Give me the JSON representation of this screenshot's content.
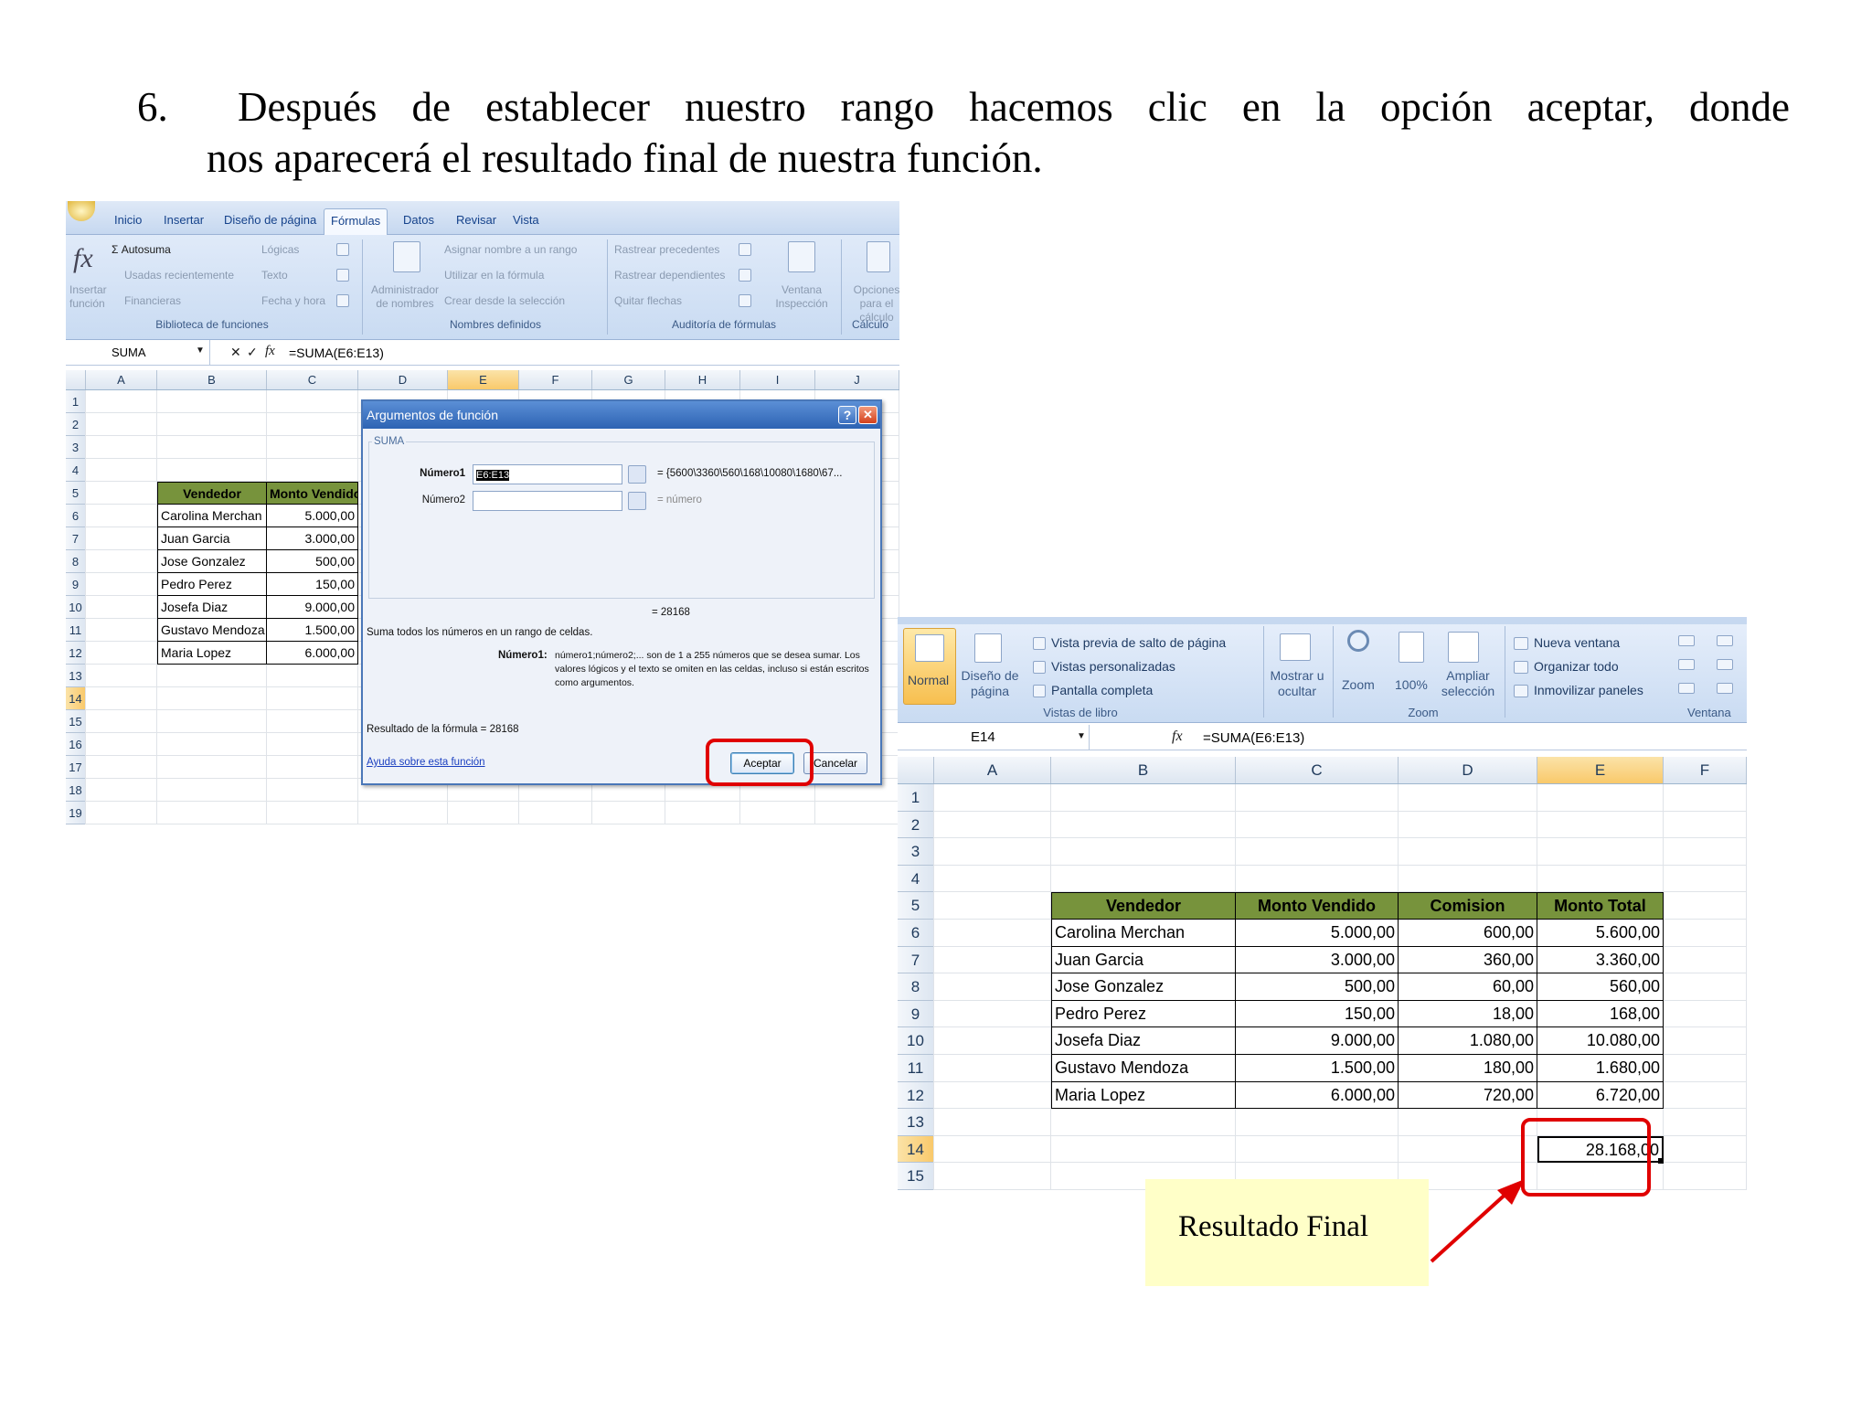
{
  "instruction": {
    "number": "6.",
    "line1": "Después de establecer nuestro rango hacemos clic en la opción  aceptar, donde",
    "line2": "nos aparecerá el resultado final de nuestra función."
  },
  "shot1": {
    "tabs": [
      "Inicio",
      "Insertar",
      "Diseño de página",
      "Fórmulas",
      "Datos",
      "Revisar",
      "Vista"
    ],
    "active_tab": "Fórmulas",
    "ribbon": {
      "insert_function": "Insertar función",
      "autosum": "Σ Autosuma",
      "recent": "Usadas recientemente",
      "financial": "Financieras",
      "logical": "Lógicas",
      "text": "Texto",
      "datetime": "Fecha y hora",
      "name_manager": "Administrador de nombres",
      "define_name": "Asignar nombre a un rango",
      "use_in_formula": "Utilizar en la fórmula",
      "create_from_selection": "Crear desde la selección",
      "trace_precedents": "Rastrear precedentes",
      "trace_dependents": "Rastrear dependientes",
      "remove_arrows": "Quitar flechas",
      "watch_window": "Ventana Inspección",
      "calc_options": "Opciones para el cálculo",
      "group_library": "Biblioteca de funciones",
      "group_names": "Nombres definidos",
      "group_audit": "Auditoría de fórmulas",
      "group_calc": "Cálculo"
    },
    "name_box": "SUMA",
    "formula": "=SUMA(E6:E13)",
    "columns": [
      "A",
      "B",
      "C",
      "D",
      "E",
      "F",
      "G",
      "H",
      "I",
      "J"
    ],
    "rows": [
      "1",
      "2",
      "3",
      "4",
      "5",
      "6",
      "7",
      "8",
      "9",
      "10",
      "11",
      "12",
      "13",
      "14",
      "15",
      "16",
      "17",
      "18",
      "19"
    ],
    "table_headers": [
      "Vendedor",
      "Monto Vendido"
    ],
    "table_rows": [
      [
        "Carolina Merchan",
        "5.000,00"
      ],
      [
        "Juan Garcia",
        "3.000,00"
      ],
      [
        "Jose Gonzalez",
        "500,00"
      ],
      [
        "Pedro Perez",
        "150,00"
      ],
      [
        "Josefa Diaz",
        "9.000,00"
      ],
      [
        "Gustavo Mendoza",
        "1.500,00"
      ],
      [
        "Maria Lopez",
        "6.000,00"
      ]
    ],
    "dialog": {
      "title": "Argumentos de función",
      "function_name": "SUMA",
      "arg1_label": "Número1",
      "arg1_value": "E6:E13",
      "arg1_preview": "= {5600\\3360\\560\\168\\10080\\1680\\67...",
      "arg2_label": "Número2",
      "arg2_preview": "= número",
      "result_preview": "= 28168",
      "description": "Suma todos los números en un rango de celdas.",
      "arg_help_label": "Número1:",
      "arg_help_line1": "número1;número2;... son de 1 a 255 números que se desea sumar. Los",
      "arg_help_line2": "valores lógicos y el texto se omiten en las celdas, incluso si están escritos",
      "arg_help_line3": "como argumentos.",
      "formula_result": "Resultado de la fórmula =  28168",
      "help_link": "Ayuda sobre esta función",
      "ok_button": "Aceptar",
      "cancel_button": "Cancelar"
    }
  },
  "shot2": {
    "ribbon": {
      "normal": "Normal",
      "page_layout": "Diseño de página",
      "page_break_preview": "Vista previa de salto de página",
      "custom_views": "Vistas personalizadas",
      "full_screen": "Pantalla completa",
      "show_hide": "Mostrar u ocultar",
      "zoom": "Zoom",
      "zoom100": "100%",
      "zoom_selection": "Ampliar selección",
      "new_window": "Nueva ventana",
      "arrange_all": "Organizar todo",
      "freeze_panes": "Inmovilizar paneles",
      "group_views": "Vistas de libro",
      "group_zoom": "Zoom",
      "group_window": "Ventana"
    },
    "name_box": "E14",
    "formula": "=SUMA(E6:E13)",
    "columns": [
      "A",
      "B",
      "C",
      "D",
      "E",
      "F"
    ],
    "rows": [
      "1",
      "2",
      "3",
      "4",
      "5",
      "6",
      "7",
      "8",
      "9",
      "10",
      "11",
      "12",
      "13",
      "14",
      "15"
    ],
    "table_headers": [
      "Vendedor",
      "Monto Vendido",
      "Comision",
      "Monto Total"
    ],
    "table_rows": [
      [
        "Carolina Merchan",
        "5.000,00",
        "600,00",
        "5.600,00"
      ],
      [
        "Juan Garcia",
        "3.000,00",
        "360,00",
        "3.360,00"
      ],
      [
        "Jose Gonzalez",
        "500,00",
        "60,00",
        "560,00"
      ],
      [
        "Pedro Perez",
        "150,00",
        "18,00",
        "168,00"
      ],
      [
        "Josefa Diaz",
        "9.000,00",
        "1.080,00",
        "10.080,00"
      ],
      [
        "Gustavo Mendoza",
        "1.500,00",
        "180,00",
        "1.680,00"
      ],
      [
        "Maria Lopez",
        "6.000,00",
        "720,00",
        "6.720,00"
      ]
    ],
    "result_value": "28.168,00"
  },
  "callout": {
    "label": "Resultado Final",
    "color": "#e00000",
    "background": "#ffffc8"
  }
}
